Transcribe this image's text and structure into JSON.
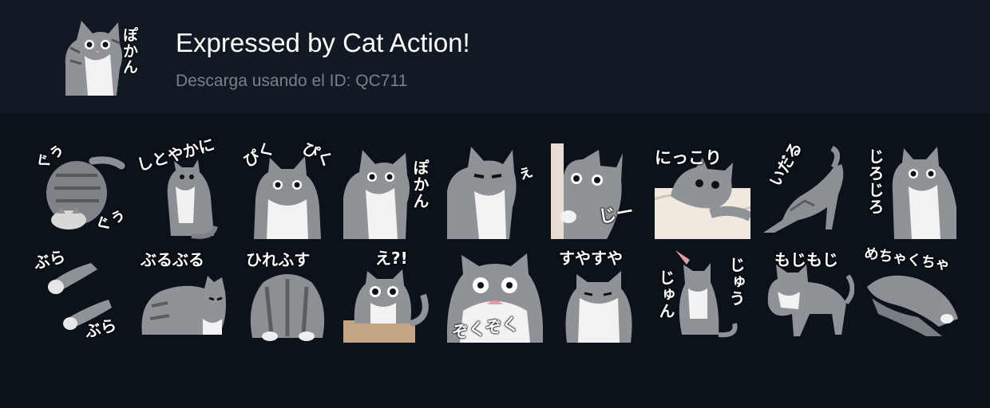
{
  "pack": {
    "title": "Expressed by Cat Action!",
    "download_text": "Descarga usando el ID: QC711",
    "thumb_text": "ぽかん"
  },
  "stickers": [
    {
      "text": "ぐぅ",
      "text2": "ぐぅ",
      "icon": "cat-sleeping-curled-icon"
    },
    {
      "text": "しとやかに",
      "icon": "cat-sitting-icon"
    },
    {
      "text": "ぴく",
      "text2": "ぴく",
      "icon": "cat-ears-twitch-icon"
    },
    {
      "text": "ぽかん",
      "icon": "cat-blank-stare-icon"
    },
    {
      "text": "ぇ",
      "icon": "cat-side-eye-icon"
    },
    {
      "text": "じー",
      "icon": "cat-peeking-icon"
    },
    {
      "text": "にっこり",
      "icon": "cat-under-blanket-icon"
    },
    {
      "text": "いだる",
      "icon": "cat-stretching-icon"
    },
    {
      "text": "じろじろ",
      "icon": "cat-staring-icon"
    },
    {
      "text": "ぶら",
      "text2": "ぶら",
      "icon": "cat-hanging-icon"
    },
    {
      "text": "ぶるぶる",
      "icon": "cat-loaf-icon"
    },
    {
      "text": "ひれふす",
      "icon": "cat-bowing-icon"
    },
    {
      "text": "え?!",
      "icon": "cat-surprised-icon"
    },
    {
      "text": "ぞくぞく",
      "icon": "cat-shivering-icon"
    },
    {
      "text": "すやすや",
      "icon": "cat-sleepy-icon"
    },
    {
      "text": "じゅん",
      "text2": "じゅう",
      "icon": "cat-drooling-icon"
    },
    {
      "text": "もじもじ",
      "icon": "cat-shy-icon"
    },
    {
      "text": "めちゃくちゃ",
      "icon": "cat-pile-icon"
    }
  ]
}
